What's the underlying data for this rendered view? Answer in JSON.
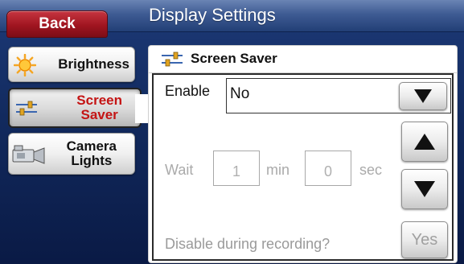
{
  "header": {
    "title": "Display Settings",
    "back_label": "Back"
  },
  "nav": {
    "items": [
      {
        "label": "Brightness",
        "icon": "sun-icon",
        "active": false
      },
      {
        "label_line1": "Screen",
        "label_line2": "Saver",
        "icon": "sliders-icon",
        "active": true
      },
      {
        "label_line1": "Camera",
        "label_line2": "Lights",
        "icon": "camera-icon",
        "active": false
      }
    ]
  },
  "panel": {
    "title": "Screen Saver",
    "icon": "sliders-icon",
    "enable_label": "Enable",
    "enable_value": "No",
    "wait_label": "Wait",
    "minutes_value": "1",
    "minutes_unit": "min",
    "seconds_value": "0",
    "seconds_unit": "sec",
    "disable_label": "Disable during recording?",
    "disable_value": "Yes"
  },
  "colors": {
    "active_nav_text": "#c41414",
    "back_button": "#a01520",
    "title_bar": "#3e5b93",
    "background": "#122a5e",
    "disabled_text": "#aaaaaa"
  }
}
